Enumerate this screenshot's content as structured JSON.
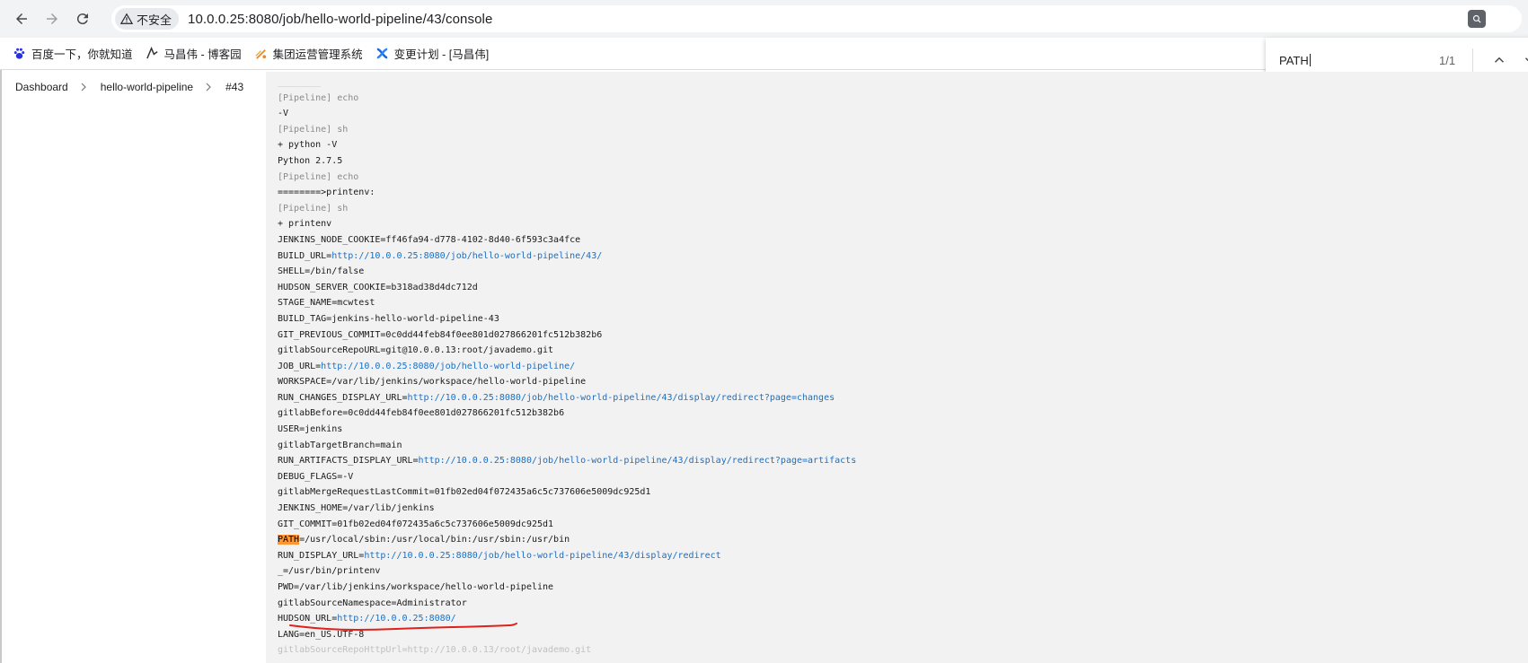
{
  "browser": {
    "security_label": "不安全",
    "url": "10.0.0.25:8080/job/hello-world-pipeline/43/console",
    "bookmarks": [
      {
        "label": "百度一下，你就知道",
        "icon": "baidu-paw-icon"
      },
      {
        "label": "马昌伟 - 博客园",
        "icon": "cnblogs-icon"
      },
      {
        "label": "集团运营管理系统",
        "icon": "flame-logo-icon"
      },
      {
        "label": "变更计划 - [马昌伟]",
        "icon": "confluence-x-icon"
      }
    ]
  },
  "find": {
    "query": "PATH",
    "count": "1/1"
  },
  "breadcrumb": [
    "Dashboard",
    "hello-world-pipeline",
    "#43"
  ],
  "console": {
    "faded_top": "________",
    "lines": [
      {
        "type": "pipeline",
        "text": "[Pipeline] echo"
      },
      {
        "type": "out",
        "text": "-V"
      },
      {
        "type": "pipeline",
        "text": "[Pipeline] sh"
      },
      {
        "type": "out",
        "text": "+ python -V"
      },
      {
        "type": "out",
        "text": "Python 2.7.5"
      },
      {
        "type": "pipeline",
        "text": "[Pipeline] echo"
      },
      {
        "type": "out",
        "text": "========>printenv:"
      },
      {
        "type": "pipeline",
        "text": "[Pipeline] sh"
      },
      {
        "type": "out",
        "text": "+ printenv"
      },
      {
        "type": "out",
        "text": "JENKINS_NODE_COOKIE=ff46fa94-d778-4102-8d40-6f593c3a4fce"
      },
      {
        "type": "link",
        "key": "BUILD_URL=",
        "url": "http://10.0.0.25:8080/job/hello-world-pipeline/43/"
      },
      {
        "type": "out",
        "text": "SHELL=/bin/false"
      },
      {
        "type": "out",
        "text": "HUDSON_SERVER_COOKIE=b318ad38d4dc712d"
      },
      {
        "type": "out",
        "text": "STAGE_NAME=mcwtest"
      },
      {
        "type": "out",
        "text": "BUILD_TAG=jenkins-hello-world-pipeline-43"
      },
      {
        "type": "out",
        "text": "GIT_PREVIOUS_COMMIT=0c0dd44feb84f0ee801d027866201fc512b382b6"
      },
      {
        "type": "out",
        "text": "gitlabSourceRepoURL=git@10.0.0.13:root/javademo.git"
      },
      {
        "type": "link",
        "key": "JOB_URL=",
        "url": "http://10.0.0.25:8080/job/hello-world-pipeline/"
      },
      {
        "type": "out",
        "text": "WORKSPACE=/var/lib/jenkins/workspace/hello-world-pipeline"
      },
      {
        "type": "link",
        "key": "RUN_CHANGES_DISPLAY_URL=",
        "url": "http://10.0.0.25:8080/job/hello-world-pipeline/43/display/redirect?page=changes"
      },
      {
        "type": "out",
        "text": "gitlabBefore=0c0dd44feb84f0ee801d027866201fc512b382b6"
      },
      {
        "type": "out",
        "text": "USER=jenkins"
      },
      {
        "type": "out",
        "text": "gitlabTargetBranch=main"
      },
      {
        "type": "link",
        "key": "RUN_ARTIFACTS_DISPLAY_URL=",
        "url": "http://10.0.0.25:8080/job/hello-world-pipeline/43/display/redirect?page=artifacts"
      },
      {
        "type": "out",
        "text": "DEBUG_FLAGS=-V"
      },
      {
        "type": "out",
        "text": "gitlabMergeRequestLastCommit=01fb02ed04f072435a6c5c737606e5009dc925d1"
      },
      {
        "type": "out",
        "text": "JENKINS_HOME=/var/lib/jenkins"
      },
      {
        "type": "out",
        "text": "GIT_COMMIT=01fb02ed04f072435a6c5c737606e5009dc925d1"
      },
      {
        "type": "match",
        "match": "PATH",
        "rest": "=/usr/local/sbin:/usr/local/bin:/usr/sbin:/usr/bin"
      },
      {
        "type": "link",
        "key": "RUN_DISPLAY_URL=",
        "url": "http://10.0.0.25:8080/job/hello-world-pipeline/43/display/redirect"
      },
      {
        "type": "out",
        "text": "_=/usr/bin/printenv"
      },
      {
        "type": "out",
        "text": "PWD=/var/lib/jenkins/workspace/hello-world-pipeline"
      },
      {
        "type": "out",
        "text": "gitlabSourceNamespace=Administrator"
      },
      {
        "type": "link",
        "key": "HUDSON_URL=",
        "url": "http://10.0.0.25:8080/"
      },
      {
        "type": "out",
        "text": "LANG=en_US.UTF-8"
      },
      {
        "type": "faded",
        "text": "gitlabSourceRepoHttpUrl=http://10.0.0.13/root/javademo.git"
      }
    ]
  },
  "colors": {
    "link": "#1a6fc4",
    "highlight": "#ff9632",
    "annotation": "#e0211b"
  }
}
